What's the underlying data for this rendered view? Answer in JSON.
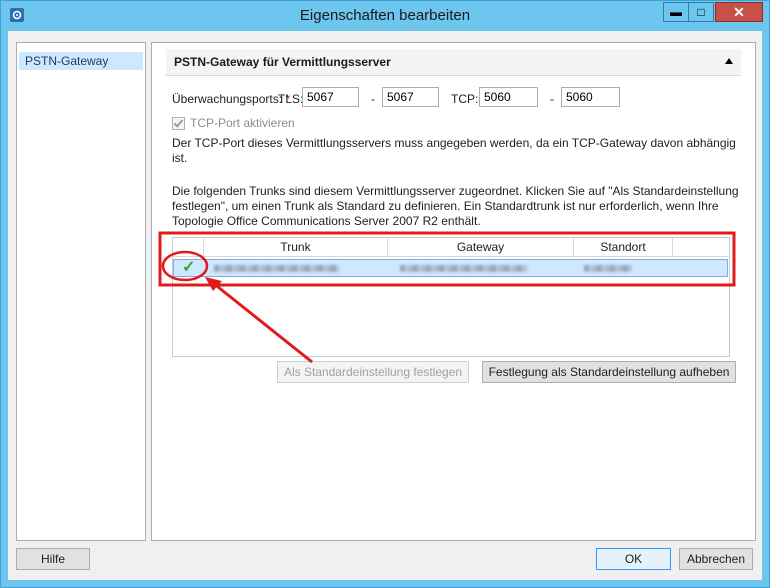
{
  "window": {
    "title": "Eigenschaften bearbeiten",
    "minimize_symbol": "▬",
    "maximize_symbol": "□",
    "close_symbol": "✕",
    "app_icon": "settings-gear-icon"
  },
  "sidebar": {
    "items": [
      {
        "label": "PSTN-Gateway",
        "selected": true
      }
    ]
  },
  "section": {
    "title": "PSTN-Gateway für Vermittlungsserver"
  },
  "ports": {
    "label": "Überwachungsports:",
    "required_mark": "*",
    "tls_label": "TLS:",
    "tls_from": "5067",
    "tls_to": "5067",
    "tcp_label": "TCP:",
    "tcp_from": "5060",
    "tcp_to": "5060",
    "dash": "-"
  },
  "tcp_checkbox": {
    "label": "TCP-Port aktivieren",
    "checked": true,
    "enabled": false
  },
  "tcp_note": "Der TCP-Port dieses Vermittlungsservers muss angegeben werden, da ein TCP-Gateway davon abhängig ist.",
  "trunk_info": "Die folgenden Trunks sind diesem Vermittlungsserver zugeordnet. Klicken Sie auf \"Als Standardeinstellung festlegen\", um einen Trunk als Standard zu definieren. Ein Standardtrunk ist nur erforderlich, wenn Ihre Topologie Office Communications Server 2007 R2 enthält.",
  "table": {
    "columns": [
      "",
      "Trunk",
      "Gateway",
      "Standort",
      ""
    ],
    "rows": [
      {
        "default_mark": "✓",
        "trunk": "",
        "gateway": "",
        "standort": ""
      }
    ]
  },
  "buttons": {
    "set_default": "Als Standardeinstellung festlegen",
    "unset_default": "Festlegung als Standardeinstellung aufheben",
    "help": "Hilfe",
    "ok": "OK",
    "cancel": "Abbrechen"
  },
  "colors": {
    "title_bar": "#6cc6ee",
    "close_button": "#c7504a",
    "selection": "#cde8ff",
    "annotation": "#e01b1b",
    "check": "#3aa53a"
  }
}
